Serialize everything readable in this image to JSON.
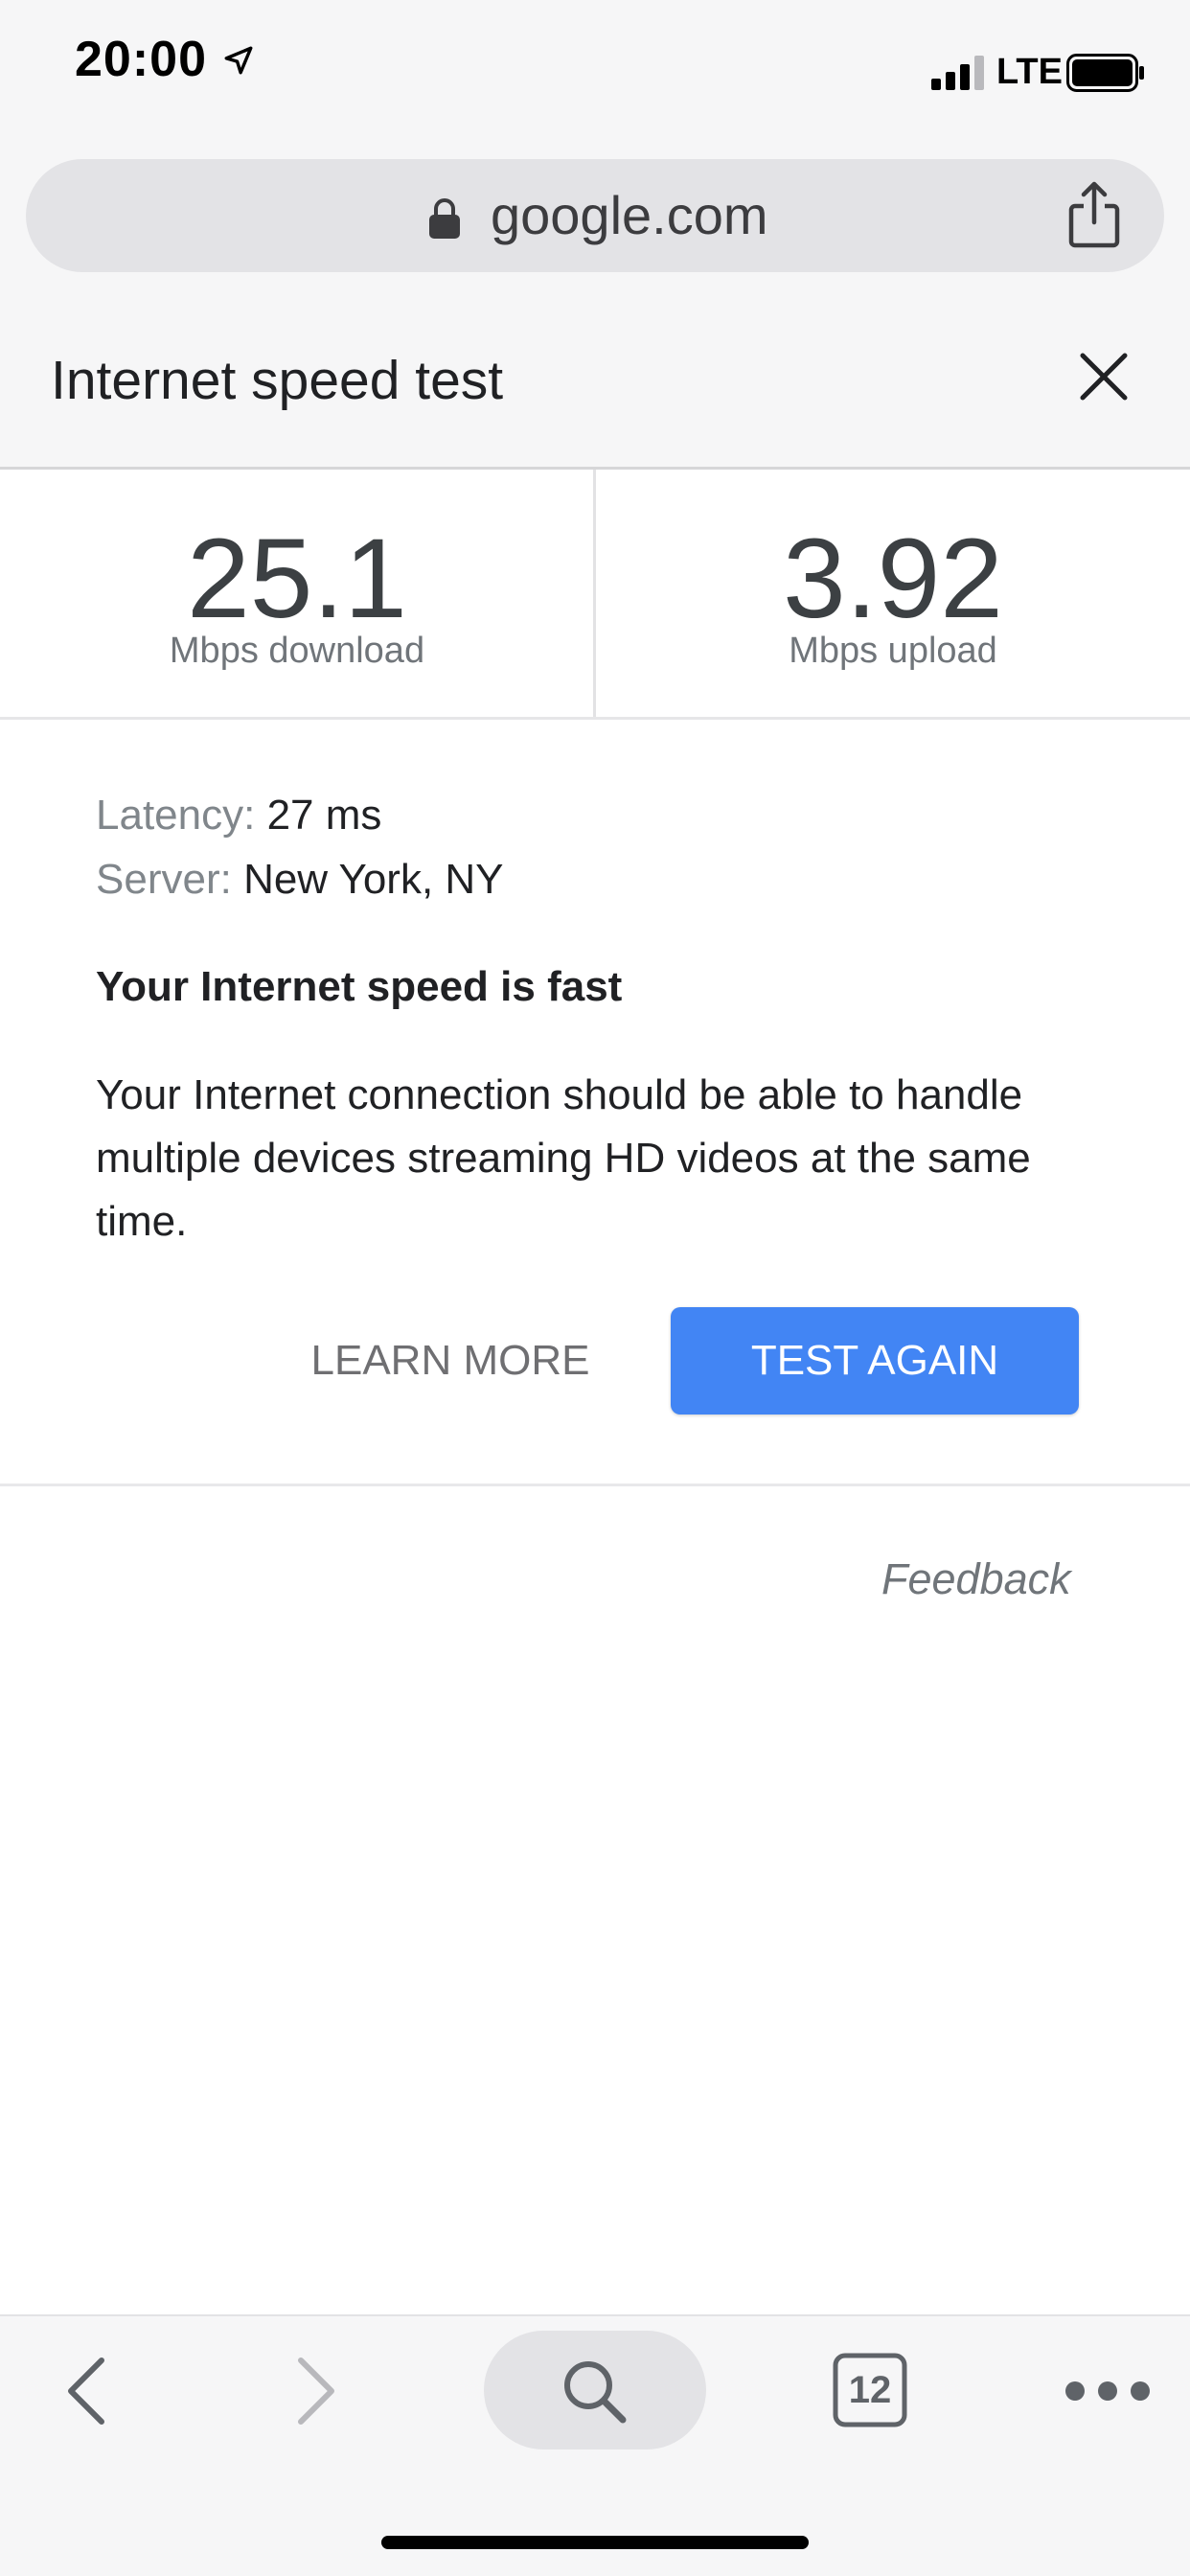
{
  "status_bar": {
    "time": "20:00",
    "network": "LTE",
    "icons": [
      "location-arrow-icon",
      "signal-bars-icon",
      "battery-icon"
    ]
  },
  "browser": {
    "url": "google.com",
    "icons": [
      "lock-icon",
      "share-icon"
    ]
  },
  "header": {
    "title": "Internet speed test",
    "close_icon": "close-icon"
  },
  "results": {
    "download": {
      "value": "25.1",
      "unit": "Mbps download"
    },
    "upload": {
      "value": "3.92",
      "unit": "Mbps upload"
    }
  },
  "details": {
    "latency_label": "Latency:",
    "latency_value": "27 ms",
    "server_label": "Server:",
    "server_value": "New York, NY"
  },
  "summary": {
    "headline": "Your Internet speed is fast",
    "description": "Your Internet connection should be able to handle multiple devices streaming HD videos at the same time."
  },
  "actions": {
    "learn_more": "LEARN MORE",
    "test_again": "TEST AGAIN"
  },
  "feedback": "Feedback",
  "toolbar": {
    "tab_count": "12",
    "icons": [
      "back-icon",
      "forward-icon",
      "search-icon",
      "tabs-icon",
      "more-icon"
    ]
  },
  "colors": {
    "accent": "#4285f4",
    "chrome_background": "#f6f6f7",
    "pill_background": "#e3e3e6"
  }
}
